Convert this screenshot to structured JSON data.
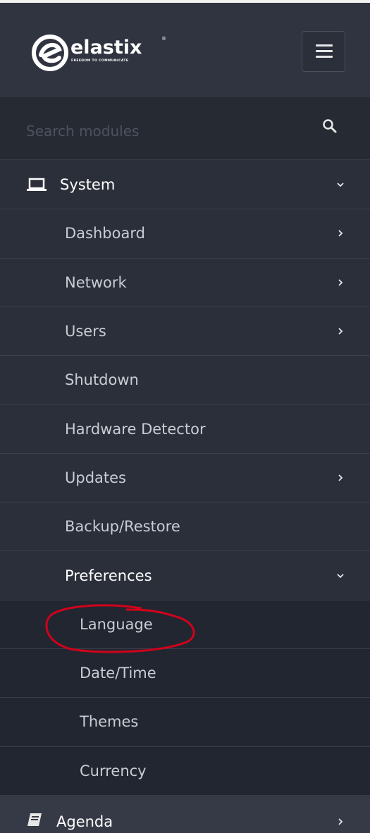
{
  "header": {
    "logo_text": "elastix",
    "logo_reg": "®",
    "logo_tagline": "FREEDOM TO COMMUNICATE",
    "menu_toggle_icon": "hamburger-icon"
  },
  "search": {
    "placeholder": "Search modules",
    "icon": "search-icon"
  },
  "menu": {
    "system": {
      "label": "System",
      "icon": "laptop-icon",
      "state": "expanded"
    },
    "sub": [
      {
        "label": "Dashboard",
        "chevron": "right"
      },
      {
        "label": "Network",
        "chevron": "right"
      },
      {
        "label": "Users",
        "chevron": "right"
      },
      {
        "label": "Shutdown",
        "chevron": ""
      },
      {
        "label": "Hardware Detector",
        "chevron": ""
      },
      {
        "label": "Updates",
        "chevron": "right"
      },
      {
        "label": "Backup/Restore",
        "chevron": ""
      },
      {
        "label": "Preferences",
        "chevron": "down"
      }
    ],
    "preferences_sub": [
      {
        "label": "Language"
      },
      {
        "label": "Date/Time"
      },
      {
        "label": "Themes"
      },
      {
        "label": "Currency"
      }
    ],
    "agenda": {
      "label": "Agenda",
      "icon": "book-icon",
      "chevron": "right"
    }
  },
  "annotation": {
    "color": "#d0021b",
    "target": "Language"
  }
}
